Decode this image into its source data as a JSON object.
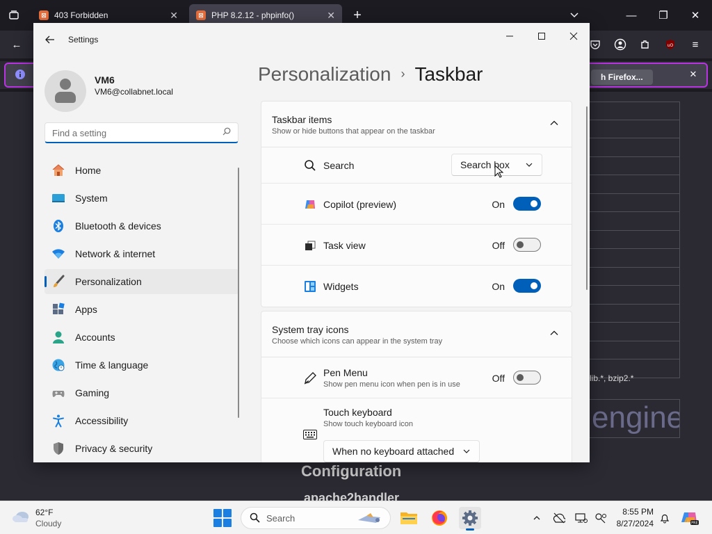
{
  "browser": {
    "tabs": [
      {
        "label": "403 Forbidden",
        "active": false
      },
      {
        "label": "PHP 8.2.12 - phpinfo()",
        "active": true
      }
    ],
    "notification_button": "h Firefox...",
    "php_text": "lib.*, bzip2.*",
    "php_engine": "engine",
    "php_configuration": "Configuration",
    "php_apache": "apache2handler"
  },
  "settings": {
    "app_title": "Settings",
    "profile": {
      "name": "VM6",
      "email": "VM6@collabnet.local"
    },
    "search": {
      "placeholder": "Find a setting"
    },
    "nav": [
      {
        "label": "Home",
        "icon": "home-icon",
        "selected": false
      },
      {
        "label": "System",
        "icon": "system-icon",
        "selected": false
      },
      {
        "label": "Bluetooth & devices",
        "icon": "bluetooth-icon",
        "selected": false
      },
      {
        "label": "Network & internet",
        "icon": "wifi-icon",
        "selected": false
      },
      {
        "label": "Personalization",
        "icon": "brush-icon",
        "selected": true
      },
      {
        "label": "Apps",
        "icon": "apps-icon",
        "selected": false
      },
      {
        "label": "Accounts",
        "icon": "accounts-icon",
        "selected": false
      },
      {
        "label": "Time & language",
        "icon": "globe-icon",
        "selected": false
      },
      {
        "label": "Gaming",
        "icon": "gamepad-icon",
        "selected": false
      },
      {
        "label": "Accessibility",
        "icon": "accessibility-icon",
        "selected": false
      },
      {
        "label": "Privacy & security",
        "icon": "shield-icon",
        "selected": false
      }
    ],
    "breadcrumb": {
      "parent": "Personalization",
      "current": "Taskbar"
    },
    "taskbar_items": {
      "title": "Taskbar items",
      "subtitle": "Show or hide buttons that appear on the taskbar",
      "search": {
        "label": "Search",
        "value": "Search box"
      },
      "copilot": {
        "label": "Copilot (preview)",
        "state": "On"
      },
      "task_view": {
        "label": "Task view",
        "state": "Off"
      },
      "widgets": {
        "label": "Widgets",
        "state": "On"
      }
    },
    "system_tray": {
      "title": "System tray icons",
      "subtitle": "Choose which icons can appear in the system tray",
      "pen_menu": {
        "label": "Pen Menu",
        "sub": "Show pen menu icon when pen is in use",
        "state": "Off"
      },
      "touch_keyboard": {
        "label": "Touch keyboard",
        "sub": "Show touch keyboard icon",
        "value": "When no keyboard attached"
      }
    }
  },
  "taskbar": {
    "weather": {
      "temp": "62°F",
      "condition": "Cloudy"
    },
    "search_label": "Search",
    "clock": {
      "time": "8:55 PM",
      "date": "8/27/2024"
    }
  },
  "colors": {
    "accent": "#005fb8",
    "firefox_bar": "#2b2a33",
    "window_bg": "#f3f3f3"
  }
}
